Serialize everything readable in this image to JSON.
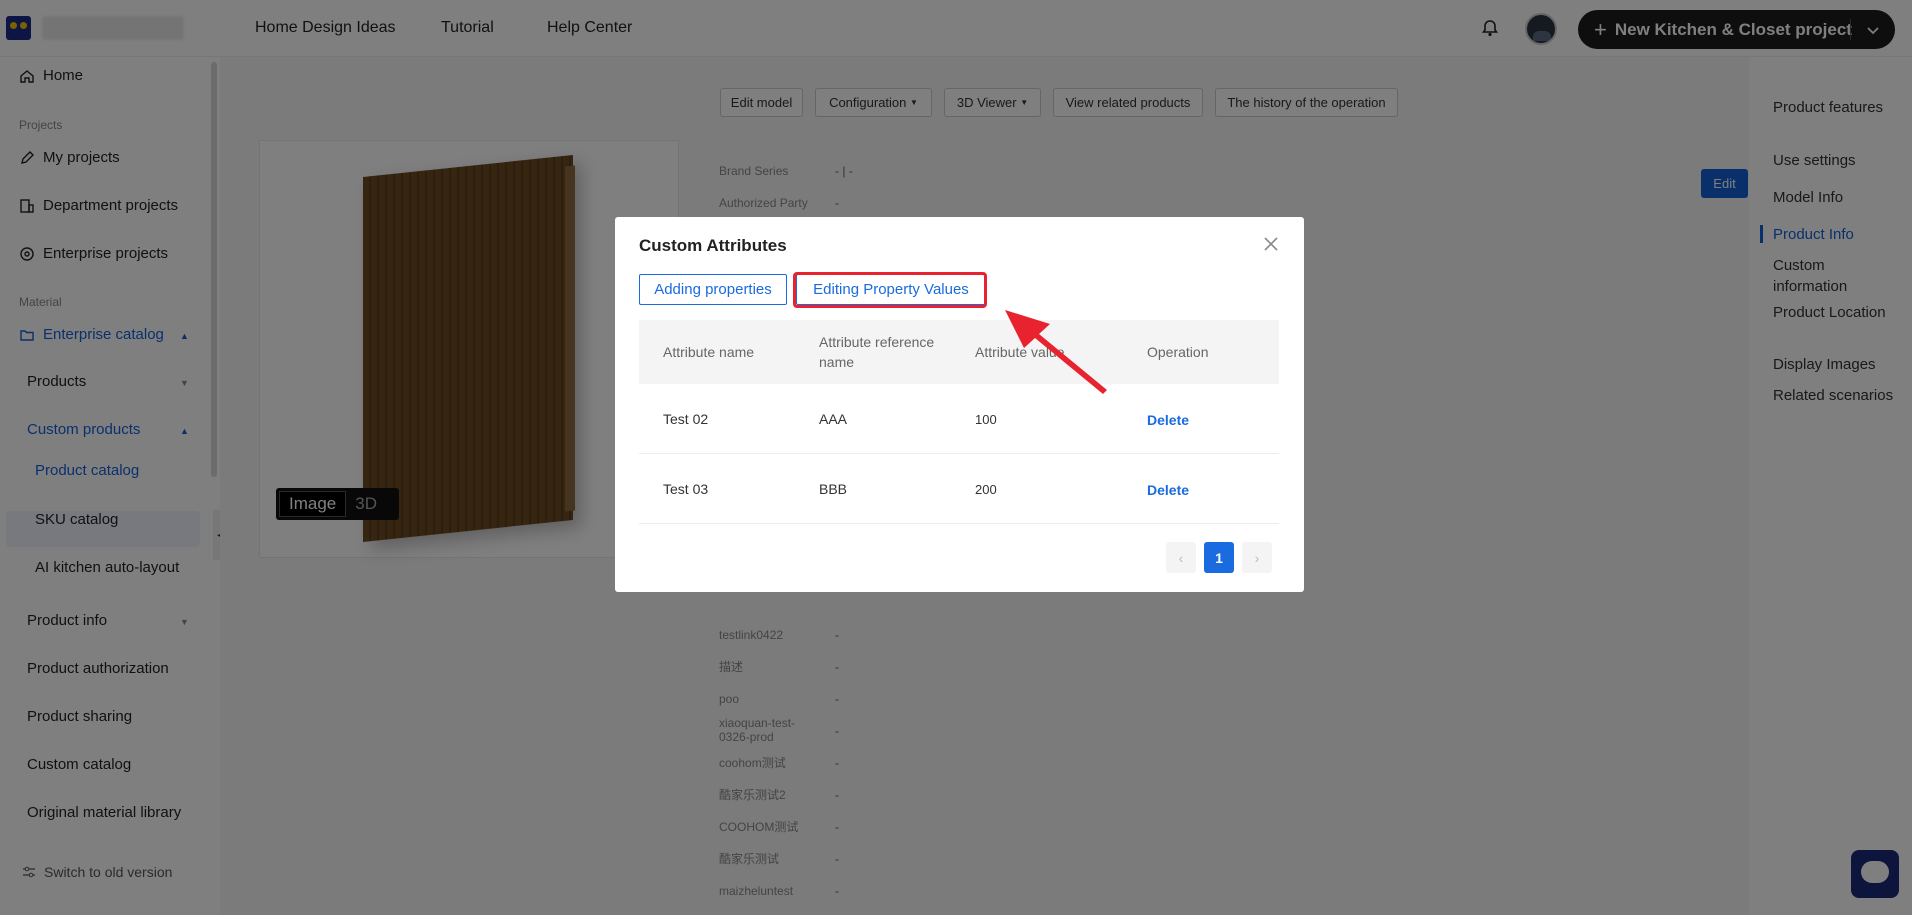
{
  "header": {
    "nav": [
      "Home Design Ideas",
      "Tutorial",
      "Help Center"
    ],
    "new_project_label": "New Kitchen & Closet project"
  },
  "sidebar": {
    "home": "Home",
    "group_projects": "Projects",
    "my_projects": "My projects",
    "department_projects": "Department projects",
    "enterprise_projects": "Enterprise projects",
    "group_material": "Material",
    "enterprise_catalog": "Enterprise catalog",
    "products": "Products",
    "custom_products": "Custom products",
    "product_catalog": "Product catalog",
    "sku_catalog": "SKU catalog",
    "ai_kitchen": "AI kitchen auto-layout",
    "product_info": "Product info",
    "product_authorization": "Product authorization",
    "product_sharing": "Product sharing",
    "custom_catalog": "Custom catalog",
    "original_material_library": "Original material library",
    "switch_old": "Switch to old version"
  },
  "toolbar": {
    "edit_model": "Edit model",
    "configuration": "Configuration",
    "viewer_3d": "3D Viewer",
    "view_related": "View related products",
    "history": "The history of the operation"
  },
  "preview": {
    "image_tab": "Image",
    "tab_3d": "3D"
  },
  "details": {
    "brand_series_label": "Brand Series",
    "brand_series_value": "- | -",
    "authorized_party_label": "Authorized Party",
    "authorized_party_value": "-",
    "edit_label": "Edit",
    "extra_attrs": [
      {
        "label": "testlink0422",
        "value": "-"
      },
      {
        "label": "描述",
        "value": "-"
      },
      {
        "label": "poo",
        "value": "-"
      },
      {
        "label": "xiaoquan-test-0326-prod",
        "value": "-"
      },
      {
        "label": "coohom测试",
        "value": "-"
      },
      {
        "label": "酷家乐测试2",
        "value": "-"
      },
      {
        "label": "COOHOM测试",
        "value": "-"
      },
      {
        "label": "酷家乐测试",
        "value": "-"
      },
      {
        "label": "maizheluntest",
        "value": "-"
      }
    ]
  },
  "toc": {
    "items": [
      "Product features",
      "Use settings",
      "Model Info",
      "Product Info",
      "Custom information",
      "Product Location",
      "Display Images",
      "Related scenarios"
    ]
  },
  "modal": {
    "title": "Custom Attributes",
    "adding_properties": "Adding properties",
    "editing_property_values": "Editing Property Values",
    "columns": [
      "Attribute name",
      "Attribute reference name",
      "Attribute value",
      "Operation"
    ],
    "rows": [
      {
        "name": "Test 02",
        "reference": "AAA",
        "value": "100",
        "operation": "Delete"
      },
      {
        "name": "Test 03",
        "reference": "BBB",
        "value": "200",
        "operation": "Delete"
      }
    ],
    "pagination": {
      "prev": "‹",
      "current_page": "1",
      "next": "›"
    }
  },
  "colors": {
    "accent": "#1b6be0",
    "highlight": "#e8222e",
    "dark_button": "#1c1c1c"
  }
}
